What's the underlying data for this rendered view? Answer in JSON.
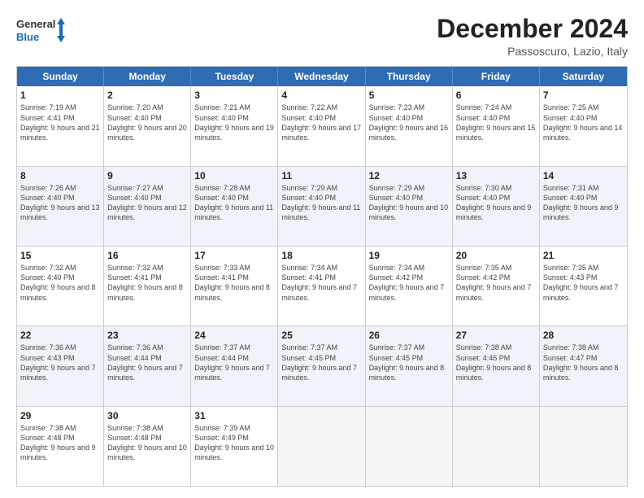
{
  "logo": {
    "line1": "General",
    "line2": "Blue"
  },
  "header": {
    "month": "December 2024",
    "location": "Passoscuro, Lazio, Italy"
  },
  "days": [
    "Sunday",
    "Monday",
    "Tuesday",
    "Wednesday",
    "Thursday",
    "Friday",
    "Saturday"
  ],
  "rows": [
    [
      {
        "day": "1",
        "sunrise": "Sunrise: 7:19 AM",
        "sunset": "Sunset: 4:41 PM",
        "daylight": "Daylight: 9 hours and 21 minutes."
      },
      {
        "day": "2",
        "sunrise": "Sunrise: 7:20 AM",
        "sunset": "Sunset: 4:40 PM",
        "daylight": "Daylight: 9 hours and 20 minutes."
      },
      {
        "day": "3",
        "sunrise": "Sunrise: 7:21 AM",
        "sunset": "Sunset: 4:40 PM",
        "daylight": "Daylight: 9 hours and 19 minutes."
      },
      {
        "day": "4",
        "sunrise": "Sunrise: 7:22 AM",
        "sunset": "Sunset: 4:40 PM",
        "daylight": "Daylight: 9 hours and 17 minutes."
      },
      {
        "day": "5",
        "sunrise": "Sunrise: 7:23 AM",
        "sunset": "Sunset: 4:40 PM",
        "daylight": "Daylight: 9 hours and 16 minutes."
      },
      {
        "day": "6",
        "sunrise": "Sunrise: 7:24 AM",
        "sunset": "Sunset: 4:40 PM",
        "daylight": "Daylight: 9 hours and 15 minutes."
      },
      {
        "day": "7",
        "sunrise": "Sunrise: 7:25 AM",
        "sunset": "Sunset: 4:40 PM",
        "daylight": "Daylight: 9 hours and 14 minutes."
      }
    ],
    [
      {
        "day": "8",
        "sunrise": "Sunrise: 7:26 AM",
        "sunset": "Sunset: 4:40 PM",
        "daylight": "Daylight: 9 hours and 13 minutes."
      },
      {
        "day": "9",
        "sunrise": "Sunrise: 7:27 AM",
        "sunset": "Sunset: 4:40 PM",
        "daylight": "Daylight: 9 hours and 12 minutes."
      },
      {
        "day": "10",
        "sunrise": "Sunrise: 7:28 AM",
        "sunset": "Sunset: 4:40 PM",
        "daylight": "Daylight: 9 hours and 11 minutes."
      },
      {
        "day": "11",
        "sunrise": "Sunrise: 7:29 AM",
        "sunset": "Sunset: 4:40 PM",
        "daylight": "Daylight: 9 hours and 11 minutes."
      },
      {
        "day": "12",
        "sunrise": "Sunrise: 7:29 AM",
        "sunset": "Sunset: 4:40 PM",
        "daylight": "Daylight: 9 hours and 10 minutes."
      },
      {
        "day": "13",
        "sunrise": "Sunrise: 7:30 AM",
        "sunset": "Sunset: 4:40 PM",
        "daylight": "Daylight: 9 hours and 9 minutes."
      },
      {
        "day": "14",
        "sunrise": "Sunrise: 7:31 AM",
        "sunset": "Sunset: 4:40 PM",
        "daylight": "Daylight: 9 hours and 9 minutes."
      }
    ],
    [
      {
        "day": "15",
        "sunrise": "Sunrise: 7:32 AM",
        "sunset": "Sunset: 4:40 PM",
        "daylight": "Daylight: 9 hours and 8 minutes."
      },
      {
        "day": "16",
        "sunrise": "Sunrise: 7:32 AM",
        "sunset": "Sunset: 4:41 PM",
        "daylight": "Daylight: 9 hours and 8 minutes."
      },
      {
        "day": "17",
        "sunrise": "Sunrise: 7:33 AM",
        "sunset": "Sunset: 4:41 PM",
        "daylight": "Daylight: 9 hours and 8 minutes."
      },
      {
        "day": "18",
        "sunrise": "Sunrise: 7:34 AM",
        "sunset": "Sunset: 4:41 PM",
        "daylight": "Daylight: 9 hours and 7 minutes."
      },
      {
        "day": "19",
        "sunrise": "Sunrise: 7:34 AM",
        "sunset": "Sunset: 4:42 PM",
        "daylight": "Daylight: 9 hours and 7 minutes."
      },
      {
        "day": "20",
        "sunrise": "Sunrise: 7:35 AM",
        "sunset": "Sunset: 4:42 PM",
        "daylight": "Daylight: 9 hours and 7 minutes."
      },
      {
        "day": "21",
        "sunrise": "Sunrise: 7:35 AM",
        "sunset": "Sunset: 4:43 PM",
        "daylight": "Daylight: 9 hours and 7 minutes."
      }
    ],
    [
      {
        "day": "22",
        "sunrise": "Sunrise: 7:36 AM",
        "sunset": "Sunset: 4:43 PM",
        "daylight": "Daylight: 9 hours and 7 minutes."
      },
      {
        "day": "23",
        "sunrise": "Sunrise: 7:36 AM",
        "sunset": "Sunset: 4:44 PM",
        "daylight": "Daylight: 9 hours and 7 minutes."
      },
      {
        "day": "24",
        "sunrise": "Sunrise: 7:37 AM",
        "sunset": "Sunset: 4:44 PM",
        "daylight": "Daylight: 9 hours and 7 minutes."
      },
      {
        "day": "25",
        "sunrise": "Sunrise: 7:37 AM",
        "sunset": "Sunset: 4:45 PM",
        "daylight": "Daylight: 9 hours and 7 minutes."
      },
      {
        "day": "26",
        "sunrise": "Sunrise: 7:37 AM",
        "sunset": "Sunset: 4:45 PM",
        "daylight": "Daylight: 9 hours and 8 minutes."
      },
      {
        "day": "27",
        "sunrise": "Sunrise: 7:38 AM",
        "sunset": "Sunset: 4:46 PM",
        "daylight": "Daylight: 9 hours and 8 minutes."
      },
      {
        "day": "28",
        "sunrise": "Sunrise: 7:38 AM",
        "sunset": "Sunset: 4:47 PM",
        "daylight": "Daylight: 9 hours and 8 minutes."
      }
    ],
    [
      {
        "day": "29",
        "sunrise": "Sunrise: 7:38 AM",
        "sunset": "Sunset: 4:48 PM",
        "daylight": "Daylight: 9 hours and 9 minutes."
      },
      {
        "day": "30",
        "sunrise": "Sunrise: 7:38 AM",
        "sunset": "Sunset: 4:48 PM",
        "daylight": "Daylight: 9 hours and 10 minutes."
      },
      {
        "day": "31",
        "sunrise": "Sunrise: 7:39 AM",
        "sunset": "Sunset: 4:49 PM",
        "daylight": "Daylight: 9 hours and 10 minutes."
      },
      null,
      null,
      null,
      null
    ]
  ]
}
